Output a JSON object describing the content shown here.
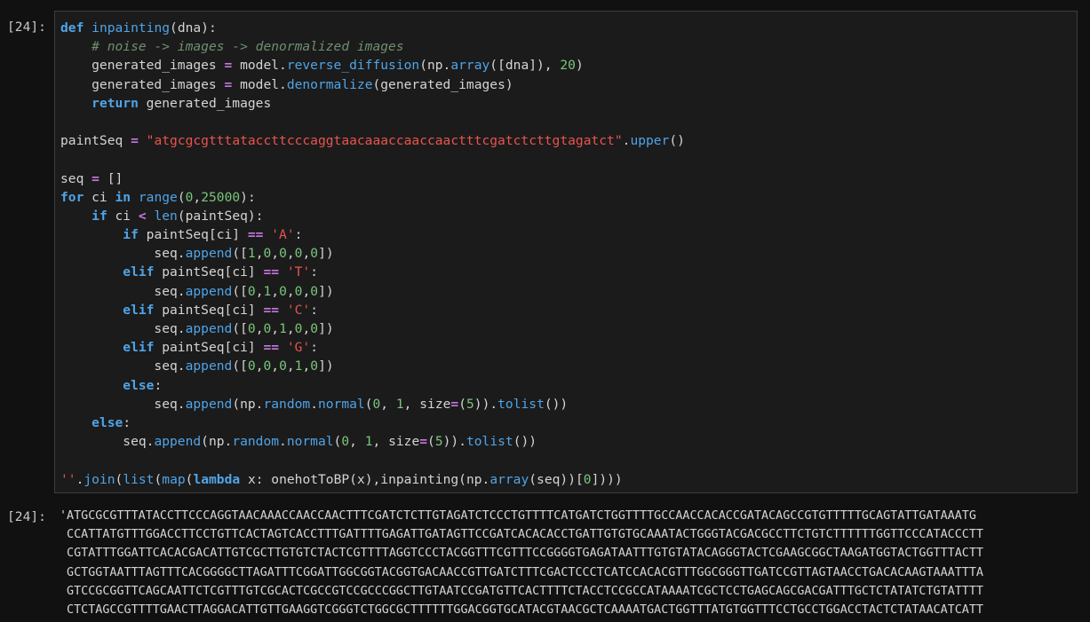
{
  "input_cell": {
    "prompt": "[24]:",
    "code_lines": [
      [
        [
          "kw",
          "def"
        ],
        [
          "",
          " "
        ],
        [
          "fn",
          "inpainting"
        ],
        [
          "",
          "(dna):"
        ]
      ],
      [
        [
          "",
          "    "
        ],
        [
          "cm",
          "# noise -> images -> denormalized images"
        ]
      ],
      [
        [
          "",
          "    generated_images "
        ],
        [
          "op",
          "="
        ],
        [
          "",
          " model."
        ],
        [
          "fn",
          "reverse_diffusion"
        ],
        [
          "",
          "(np."
        ],
        [
          "fn",
          "array"
        ],
        [
          "",
          "([dna]), "
        ],
        [
          "num",
          "20"
        ],
        [
          "",
          ")"
        ]
      ],
      [
        [
          "",
          "    generated_images "
        ],
        [
          "op",
          "="
        ],
        [
          "",
          " model."
        ],
        [
          "fn",
          "denormalize"
        ],
        [
          "",
          "(generated_images)"
        ]
      ],
      [
        [
          "",
          "    "
        ],
        [
          "kw",
          "return"
        ],
        [
          "",
          " generated_images"
        ]
      ],
      [
        [
          "",
          ""
        ]
      ],
      [
        [
          "",
          "paintSeq "
        ],
        [
          "op",
          "="
        ],
        [
          "",
          " "
        ],
        [
          "str",
          "\"atgcgcgtttataccttcccaggtaacaaaccaaccaactttcgatctcttgtagatct\""
        ],
        [
          "",
          "."
        ],
        [
          "fn",
          "upper"
        ],
        [
          "",
          "()"
        ]
      ],
      [
        [
          "",
          ""
        ]
      ],
      [
        [
          "",
          "seq "
        ],
        [
          "op",
          "="
        ],
        [
          "",
          " []"
        ]
      ],
      [
        [
          "kw",
          "for"
        ],
        [
          "",
          " ci "
        ],
        [
          "kw2",
          "in"
        ],
        [
          "",
          " "
        ],
        [
          "bi",
          "range"
        ],
        [
          "",
          "("
        ],
        [
          "num",
          "0"
        ],
        [
          "",
          ","
        ],
        [
          "num",
          "25000"
        ],
        [
          "",
          "):"
        ]
      ],
      [
        [
          "",
          "    "
        ],
        [
          "kw",
          "if"
        ],
        [
          "",
          " ci "
        ],
        [
          "op",
          "<"
        ],
        [
          "",
          " "
        ],
        [
          "bi",
          "len"
        ],
        [
          "",
          "(paintSeq):"
        ]
      ],
      [
        [
          "",
          "        "
        ],
        [
          "kw",
          "if"
        ],
        [
          "",
          " paintSeq[ci] "
        ],
        [
          "op",
          "=="
        ],
        [
          "",
          " "
        ],
        [
          "str",
          "'A'"
        ],
        [
          "",
          ":"
        ]
      ],
      [
        [
          "",
          "            seq."
        ],
        [
          "fn",
          "append"
        ],
        [
          "",
          "(["
        ],
        [
          "num",
          "1"
        ],
        [
          "",
          ","
        ],
        [
          "num",
          "0"
        ],
        [
          "",
          ","
        ],
        [
          "num",
          "0"
        ],
        [
          "",
          ","
        ],
        [
          "num",
          "0"
        ],
        [
          "",
          ","
        ],
        [
          "num",
          "0"
        ],
        [
          "",
          "])"
        ]
      ],
      [
        [
          "",
          "        "
        ],
        [
          "kw",
          "elif"
        ],
        [
          "",
          " paintSeq[ci] "
        ],
        [
          "op",
          "=="
        ],
        [
          "",
          " "
        ],
        [
          "str",
          "'T'"
        ],
        [
          "",
          ":"
        ]
      ],
      [
        [
          "",
          "            seq."
        ],
        [
          "fn",
          "append"
        ],
        [
          "",
          "(["
        ],
        [
          "num",
          "0"
        ],
        [
          "",
          ","
        ],
        [
          "num",
          "1"
        ],
        [
          "",
          ","
        ],
        [
          "num",
          "0"
        ],
        [
          "",
          ","
        ],
        [
          "num",
          "0"
        ],
        [
          "",
          ","
        ],
        [
          "num",
          "0"
        ],
        [
          "",
          "])"
        ]
      ],
      [
        [
          "",
          "        "
        ],
        [
          "kw",
          "elif"
        ],
        [
          "",
          " paintSeq[ci] "
        ],
        [
          "op",
          "=="
        ],
        [
          "",
          " "
        ],
        [
          "str",
          "'C'"
        ],
        [
          "",
          ":"
        ]
      ],
      [
        [
          "",
          "            seq."
        ],
        [
          "fn",
          "append"
        ],
        [
          "",
          "(["
        ],
        [
          "num",
          "0"
        ],
        [
          "",
          ","
        ],
        [
          "num",
          "0"
        ],
        [
          "",
          ","
        ],
        [
          "num",
          "1"
        ],
        [
          "",
          ","
        ],
        [
          "num",
          "0"
        ],
        [
          "",
          ","
        ],
        [
          "num",
          "0"
        ],
        [
          "",
          "])"
        ]
      ],
      [
        [
          "",
          "        "
        ],
        [
          "kw",
          "elif"
        ],
        [
          "",
          " paintSeq[ci] "
        ],
        [
          "op",
          "=="
        ],
        [
          "",
          " "
        ],
        [
          "str",
          "'G'"
        ],
        [
          "",
          ":"
        ]
      ],
      [
        [
          "",
          "            seq."
        ],
        [
          "fn",
          "append"
        ],
        [
          "",
          "(["
        ],
        [
          "num",
          "0"
        ],
        [
          "",
          ","
        ],
        [
          "num",
          "0"
        ],
        [
          "",
          ","
        ],
        [
          "num",
          "0"
        ],
        [
          "",
          ","
        ],
        [
          "num",
          "1"
        ],
        [
          "",
          ","
        ],
        [
          "num",
          "0"
        ],
        [
          "",
          "])"
        ]
      ],
      [
        [
          "",
          "        "
        ],
        [
          "kw",
          "else"
        ],
        [
          "",
          ":"
        ]
      ],
      [
        [
          "",
          "            seq."
        ],
        [
          "fn",
          "append"
        ],
        [
          "",
          "(np."
        ],
        [
          "fn",
          "random"
        ],
        [
          "",
          "."
        ],
        [
          "fn",
          "normal"
        ],
        [
          "",
          "("
        ],
        [
          "num",
          "0"
        ],
        [
          "",
          ", "
        ],
        [
          "num",
          "1"
        ],
        [
          "",
          ", size"
        ],
        [
          "op",
          "="
        ],
        [
          "",
          "("
        ],
        [
          "num",
          "5"
        ],
        [
          "",
          "))."
        ],
        [
          "fn",
          "tolist"
        ],
        [
          "",
          "())"
        ]
      ],
      [
        [
          "",
          "    "
        ],
        [
          "kw",
          "else"
        ],
        [
          "",
          ":"
        ]
      ],
      [
        [
          "",
          "        seq."
        ],
        [
          "fn",
          "append"
        ],
        [
          "",
          "(np."
        ],
        [
          "fn",
          "random"
        ],
        [
          "",
          "."
        ],
        [
          "fn",
          "normal"
        ],
        [
          "",
          "("
        ],
        [
          "num",
          "0"
        ],
        [
          "",
          ", "
        ],
        [
          "num",
          "1"
        ],
        [
          "",
          ", size"
        ],
        [
          "op",
          "="
        ],
        [
          "",
          "("
        ],
        [
          "num",
          "5"
        ],
        [
          "",
          "))."
        ],
        [
          "fn",
          "tolist"
        ],
        [
          "",
          "())"
        ]
      ],
      [
        [
          "",
          ""
        ]
      ],
      [
        [
          "str",
          "''"
        ],
        [
          "",
          "."
        ],
        [
          "fn",
          "join"
        ],
        [
          "",
          "("
        ],
        [
          "bi",
          "list"
        ],
        [
          "",
          "("
        ],
        [
          "bi",
          "map"
        ],
        [
          "",
          "("
        ],
        [
          "kw",
          "lambda"
        ],
        [
          "",
          " x: onehotToBP(x),inpainting(np."
        ],
        [
          "fn",
          "array"
        ],
        [
          "",
          "(seq))["
        ],
        [
          "num",
          "0"
        ],
        [
          "",
          "])))"
        ]
      ]
    ]
  },
  "output_cell": {
    "prompt": "[24]:",
    "lines": [
      "'ATGCGCGTTTATACCTTCCCAGGTAACAAACCAACCAACTTTCGATCTCTTGTAGATCTCCCTGTTTTCATGATCTGGTTTTGCCAACCACACCGATACAGCCGTGTTTTTGCAGTATTGATAAATG",
      " CCATTATGTTTGGACCTTCCTGTTCACTAGTCACCTTTGATTTTGAGATTGATAGTTCCGATCACACACCTGATTGTGTGCAAATACTGGGTACGACGCCTTCTGTCTTTTTTGGTTCCCATACCCTT",
      " CGTATTTGGATTCACACGACATTGTCGCTTGTGTCTACTCGTTTTAGGTCCCTACGGTTTCGTTTCCGGGGTGAGATAATTTGTGTATACAGGGTACTCGAAGCGGCTAAGATGGTACTGGTTTACTT",
      " GCTGGTAATTTAGTTTCACGGGGCTTAGATTTCGGATTGGCGGTACGGTGACAACCGTTGATCTTTCGACTCCCTCATCCACACGTTTGGCGGGTTGATCCGTTAGTAACCTGACACAAGTAAATTTA",
      " GTCCGCGGTTCAGCAATTCTCGTTTGTCGCACTCGCCGTCCGCCCGGCTTGTAATCCGATGTTCACTTTTCTACCTCCGCCATAAAATCGCTCCTGAGCAGCGACGATTTGCTCTATATCTGTATTTT",
      " CTCTAGCCGTTTTGAACTTAGGACATTGTTGAAGGTCGGGTCTGGCGCTTTTTTGGACGGTGCATACGTAACGCTCAAAATGACTGGTTTATGTGGTTTCCTGCCTGGACCTACTCTATAACATCATT"
    ]
  },
  "colors": {
    "background": "#111111",
    "editor_background": "#1b1b1b",
    "keyword": "#4fa4e8",
    "string": "#e9534f",
    "number": "#7bc67b",
    "operator": "#c678dd",
    "comment": "#6f8f6f"
  }
}
